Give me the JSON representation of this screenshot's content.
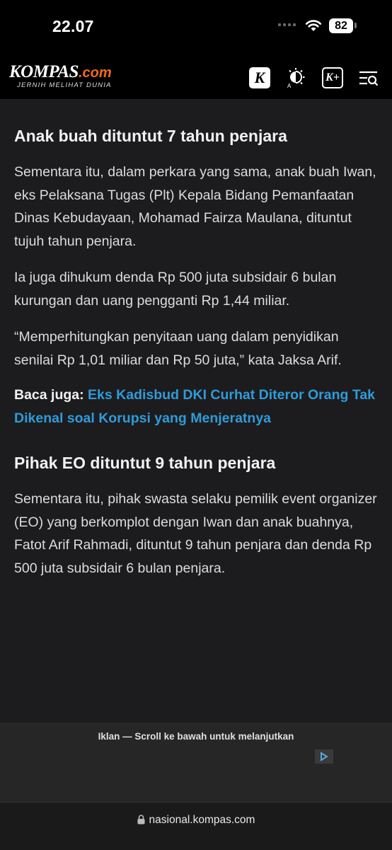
{
  "status_bar": {
    "time": "22.07",
    "battery": "82"
  },
  "header": {
    "logo": "KOMPAS",
    "logo_suffix": ".com",
    "tagline": "JERNIH MELIHAT DUNIA",
    "k_icon_label": "K",
    "kplus_label": "K+"
  },
  "article": {
    "section1_heading": "Anak buah dituntut 7 tahun penjara",
    "para1": "Sementara itu, dalam perkara yang sama, anak buah Iwan, eks Pelaksana Tugas (Plt) Kepala Bidang Pemanfaatan Dinas Kebudayaan, Mohamad Fairza Maulana, dituntut tujuh tahun penjara.",
    "para2": "Ia juga dihukum denda Rp 500 juta subsidair 6 bulan kurungan dan uang pengganti Rp 1,44 miliar.",
    "para3": "“Memperhitungkan penyitaan uang dalam penyidikan senilai Rp 1,01 miliar dan Rp 50 juta,” kata Jaksa Arif.",
    "read_also_label": "Baca juga:",
    "read_also_link": "Eks Kadisbud DKI Curhat Diteror Orang Tak Dikenal soal Korupsi yang Menjeratnya",
    "section2_heading": "Pihak EO dituntut 9 tahun penjara",
    "para4": "Sementara itu, pihak swasta selaku pemilik event organizer (EO) yang berkomplot dengan Iwan dan anak buahnya, Fatot Arif Rahmadi, dituntut 9 tahun penjara dan denda Rp 500 juta subsidair 6 bulan penjara."
  },
  "ad": {
    "text": "Iklan — Scroll ke bawah untuk melanjutkan"
  },
  "browser": {
    "url": "nasional.kompas.com"
  },
  "colors": {
    "link": "#2f9bd9",
    "brand_orange": "#f26a1c",
    "article_bg": "#1c1c1e"
  }
}
